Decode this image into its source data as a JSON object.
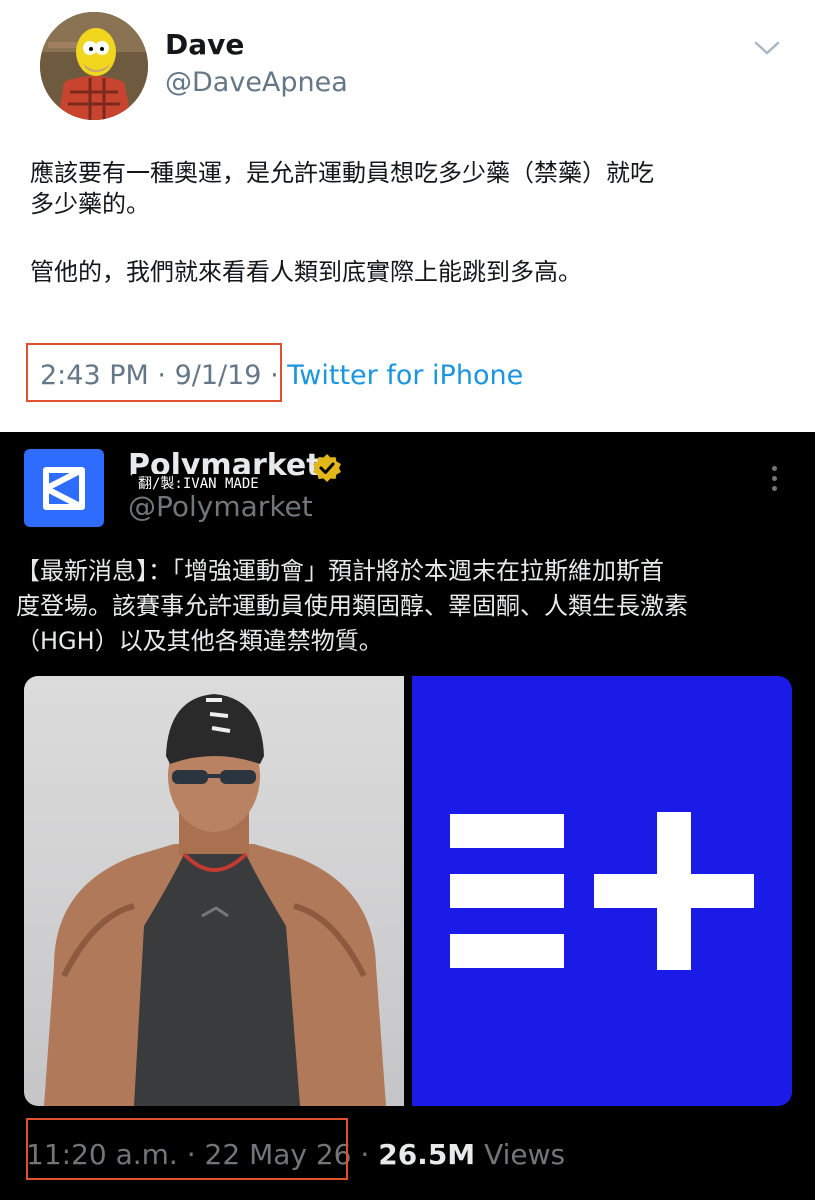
{
  "top_tweet": {
    "name": "Dave",
    "handle": "@DaveApnea",
    "avatar_icon": "homer-simpson-avatar",
    "text_lines": [
      "應該要有一種奧運，是允許運動員想吃多少藥（禁藥）就吃",
      "多少藥的。",
      "管他的，我們就來看看人類到底實際上能跳到多高。"
    ],
    "time": "2:43 PM",
    "separator": "·",
    "date": "9/1/19",
    "client": "Twitter for iPhone"
  },
  "bottom_tweet": {
    "name": "Polymarket",
    "handle": "@Polymarket",
    "watermark": "翻/製:IVAN MADE",
    "logo_icon": "polymarket-logo-icon",
    "verified_icon": "verified-badge-icon",
    "text_lines": [
      "【最新消息】：「增強運動會」預計將於本週末在拉斯維加斯首",
      "度登場。該賽事允許運動員使用類固醇、睪固酮、人類生長激素",
      "（HGH）以及其他各類違禁物質。"
    ],
    "time": "11:20 a.m.",
    "separator": "·",
    "date": "22 May 26",
    "views_count": "26.5M",
    "views_label": "Views"
  },
  "colors": {
    "highlight_box": "#e0502f",
    "link_blue": "#1b95e0",
    "logo_blue": "#2d6cff",
    "enhanced_blue": "#1b1be8"
  }
}
